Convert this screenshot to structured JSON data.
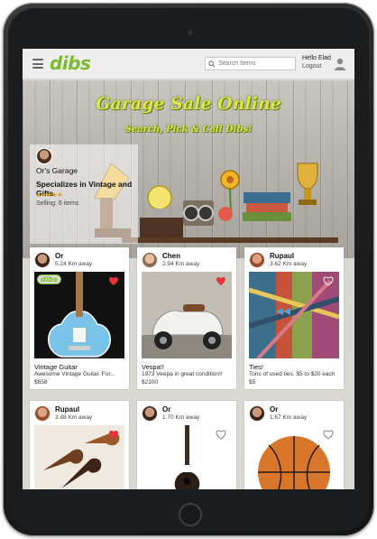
{
  "app": {
    "logo": "dibs",
    "search_placeholder": "Search Items",
    "greeting": "Hello Elad",
    "logout_label": "Logout"
  },
  "hero": {
    "title": "Garage Sale Online",
    "subtitle": "Search, Pick & Call Dibs!",
    "shop": {
      "name": "Or's Garage",
      "tagline": "Specializes in Vintage and Gifts",
      "rating": "★★★★★",
      "selling": "Selling: 6 items"
    }
  },
  "items": [
    {
      "seller": "Or",
      "distance": "5.24 Km away",
      "title": "Vintage Guitar",
      "description": "Awesome Vintage Guitar. For...",
      "price": "$658",
      "badge": "dibs",
      "liked": true
    },
    {
      "seller": "Chen",
      "distance": "2.94 Km away",
      "title": "Vespa!!",
      "description": "1973 Veepa in great condition!!",
      "price": "$2100",
      "liked": true
    },
    {
      "seller": "Rupaul",
      "distance": "3.62 Km away",
      "title": "Ties!",
      "description": "Tons of used ties. $5 to $20 each",
      "price": "$5",
      "liked": false
    },
    {
      "seller": "Rupaul",
      "distance": "3.88 Km away",
      "liked": true
    },
    {
      "seller": "Or",
      "distance": "1.70 Km away",
      "liked": false
    },
    {
      "seller": "Or",
      "distance": "1.67 Km away",
      "liked": false
    }
  ],
  "colors": {
    "brand": "#7dbb2e",
    "heart_active": "#e8343a",
    "hero_text": "#d7e84a"
  },
  "icons": {
    "menu": "hamburger-icon",
    "search": "search-icon",
    "user": "user-icon",
    "like": "heart-icon"
  }
}
